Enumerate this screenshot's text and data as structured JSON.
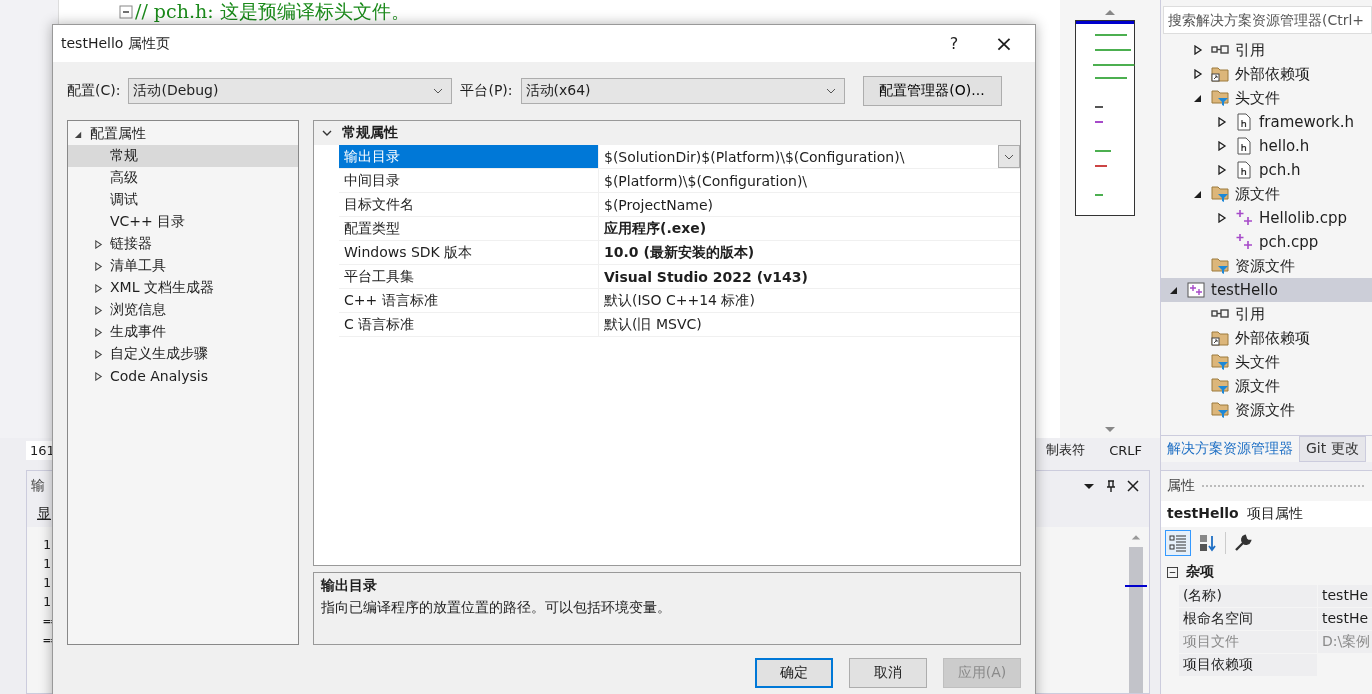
{
  "editor": {
    "code_line": "// pch.h: 这是预编译标头文件。",
    "line_field": "161"
  },
  "status_bar": {
    "items": [
      "制表符",
      "CRLF"
    ]
  },
  "output_panel": {
    "title": "输",
    "toolbar_label": "显",
    "lines": [
      "1",
      "1",
      "1",
      "1",
      "==",
      "=="
    ]
  },
  "solution_explorer": {
    "search": {
      "placeholder": "搜索解决方案资源管理器(Ctrl+"
    },
    "tree_continued": [
      {
        "label": "引用",
        "kind": "reference",
        "expanded": false,
        "selected": false
      },
      {
        "label": "外部依赖项",
        "kind": "external",
        "expanded": false,
        "selected": false
      },
      {
        "label": "头文件",
        "kind": "filter",
        "expanded": true,
        "selected": false,
        "children": [
          {
            "label": "framework.h",
            "kind": "header",
            "expanded": false,
            "selected": false
          },
          {
            "label": "hello.h",
            "kind": "header",
            "expanded": false,
            "selected": false
          },
          {
            "label": "pch.h",
            "kind": "header",
            "expanded": false,
            "selected": false
          }
        ]
      },
      {
        "label": "源文件",
        "kind": "filter",
        "expanded": true,
        "selected": false,
        "children": [
          {
            "label": "Hellolib.cpp",
            "kind": "cpp",
            "expanded": false,
            "selected": false
          },
          {
            "label": "pch.cpp",
            "kind": "cpp",
            "selected": false
          }
        ]
      },
      {
        "label": "资源文件",
        "kind": "filter",
        "selected": false
      }
    ],
    "tree": [
      {
        "label": "testHello",
        "kind": "project",
        "expanded": true,
        "selected": true,
        "children": [
          {
            "label": "引用",
            "kind": "reference",
            "selected": false
          },
          {
            "label": "外部依赖项",
            "kind": "external",
            "selected": false
          },
          {
            "label": "头文件",
            "kind": "filter",
            "selected": false
          },
          {
            "label": "源文件",
            "kind": "filter",
            "selected": false
          },
          {
            "label": "资源文件",
            "kind": "filter",
            "selected": false
          }
        ]
      }
    ],
    "tabs": [
      {
        "label": "解决方案资源管理器",
        "selected": true
      },
      {
        "label": "Git 更改",
        "selected": false
      }
    ]
  },
  "properties_panel": {
    "title": "属性",
    "object_name": "testHello",
    "object_type": "项目属性",
    "toolbar": [
      {
        "kind": "categorized",
        "selected": true
      },
      {
        "kind": "alphabetical",
        "selected": false
      },
      {
        "kind": "property_pages",
        "selected": false
      }
    ],
    "category": {
      "label": "杂项",
      "expanded": true
    },
    "rows": [
      {
        "name": "(名称)",
        "value": "testHe",
        "disabled": false
      },
      {
        "name": "根命名空间",
        "value": "testHe",
        "disabled": false
      },
      {
        "name": "项目文件",
        "value": "D:\\案例",
        "disabled": true
      },
      {
        "name": "项目依赖项",
        "disabled": false
      }
    ]
  },
  "dialog": {
    "title": "testHello 属性页",
    "help": "?",
    "close": "×",
    "configuration": {
      "label": "配置(C):",
      "value": "活动(Debug)"
    },
    "platform": {
      "label": "平台(P):",
      "value": "活动(x64)"
    },
    "manager_button": "配置管理器(O)...",
    "nav_tree": [
      {
        "label": "配置属性",
        "expanded": true,
        "selected": false,
        "children": [
          {
            "label": "常规",
            "selected": true
          },
          {
            "label": "高级",
            "selected": false
          },
          {
            "label": "调试",
            "selected": false
          },
          {
            "label": "VC++ 目录",
            "selected": false
          },
          {
            "label": "链接器",
            "expanded": false,
            "selected": false
          },
          {
            "label": "清单工具",
            "expanded": false,
            "selected": false
          },
          {
            "label": "XML 文档生成器",
            "expanded": false,
            "selected": false
          },
          {
            "label": "浏览信息",
            "expanded": false,
            "selected": false
          },
          {
            "label": "生成事件",
            "expanded": false,
            "selected": false
          },
          {
            "label": "自定义生成步骤",
            "expanded": false,
            "selected": false
          },
          {
            "label": "Code Analysis",
            "expanded": false,
            "selected": false
          }
        ]
      }
    ],
    "grid": {
      "category": {
        "label": "常规属性",
        "expanded": true
      },
      "rows": [
        {
          "name": "输出目录",
          "value": "$(SolutionDir)$(Platform)\\$(Configuration)\\",
          "bold": false,
          "selected": true
        },
        {
          "name": "中间目录",
          "value": "$(Platform)\\$(Configuration)\\",
          "bold": false,
          "selected": false
        },
        {
          "name": "目标文件名",
          "value": "$(ProjectName)",
          "bold": false,
          "selected": false
        },
        {
          "name": "配置类型",
          "value": "应用程序(.exe)",
          "bold": true,
          "selected": false
        },
        {
          "name": "Windows SDK 版本",
          "value": "10.0 (最新安装的版本)",
          "bold": true,
          "selected": false
        },
        {
          "name": "平台工具集",
          "value": "Visual Studio 2022 (v143)",
          "bold": true,
          "selected": false
        },
        {
          "name": "C++ 语言标准",
          "value": "默认(ISO C++14 标准)",
          "bold": false,
          "selected": false
        },
        {
          "name": "C 语言标准",
          "value": "默认(旧 MSVC)",
          "bold": false,
          "selected": false
        }
      ]
    },
    "description": {
      "title": "输出目录",
      "text": "指向已编译程序的放置位置的路径。可以包括环境变量。"
    },
    "buttons": [
      {
        "label": "确定",
        "kind": "default",
        "disabled": false
      },
      {
        "label": "取消",
        "kind": "normal",
        "disabled": false
      },
      {
        "label": "应用(A)",
        "kind": "normal",
        "disabled": true
      }
    ]
  }
}
